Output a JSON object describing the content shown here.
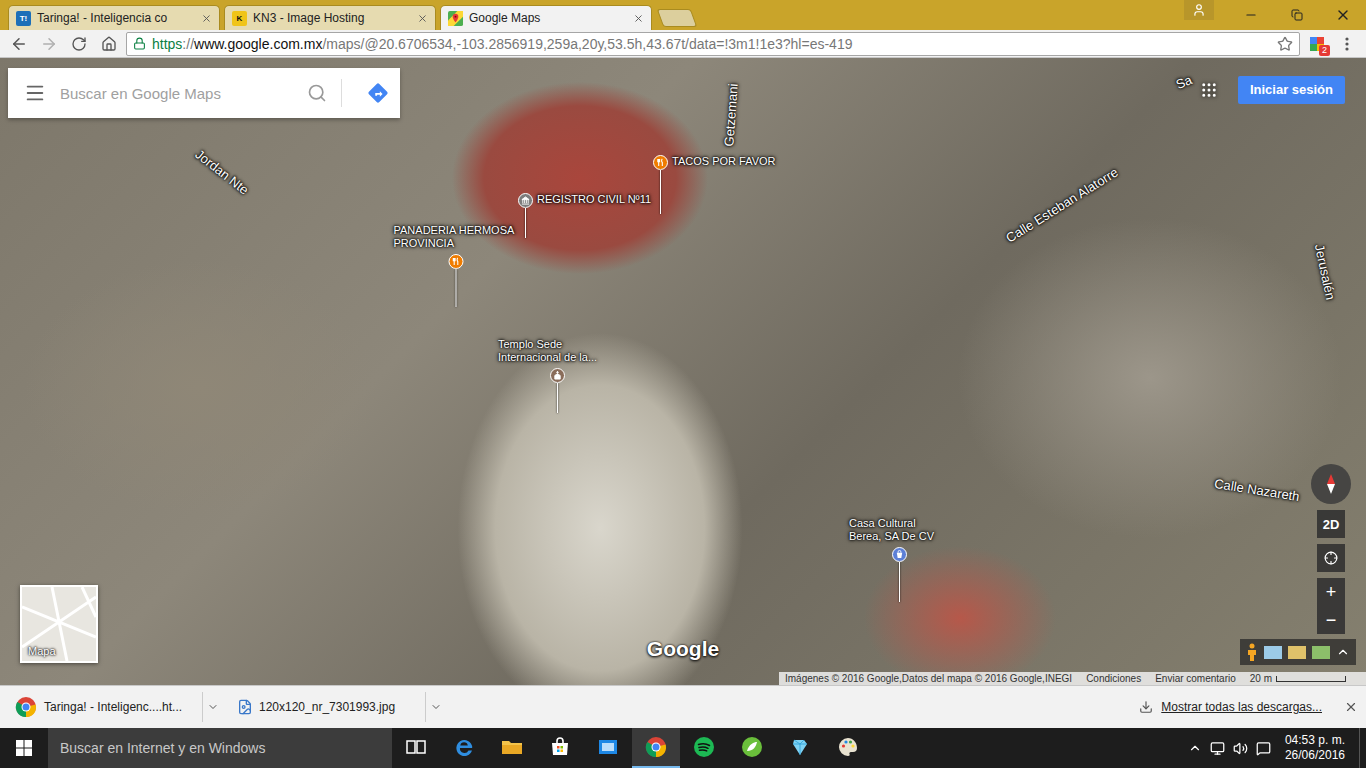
{
  "browser": {
    "tabs": [
      {
        "label": "Taringa! - Inteligencia co",
        "kind": "letter",
        "favicon": "T!",
        "selected": false
      },
      {
        "label": "KN3 - Image Hosting",
        "kind": "letter",
        "favicon": "K",
        "selected": false
      },
      {
        "label": "Google Maps",
        "kind": "maps",
        "favicon": "",
        "selected": true
      }
    ],
    "url": {
      "scheme": "https",
      "separator": "://",
      "host": "www.google.com.mx",
      "path": "/maps/@20.6706534,-103.2856919,259a,20y,53.5h,43.67t/data=!3m1!1e3?hl=es-419"
    },
    "bookmarked": false,
    "extension_badge": "2"
  },
  "map": {
    "search_placeholder": "Buscar en Google Maps",
    "sign_in": "Iniciar sesión",
    "streets": [
      "Jordan Nte",
      "Getzemani",
      "Calle Esteban Alatorre",
      "Jerusalén",
      "Calle Nazareth",
      "Sa"
    ],
    "places": [
      {
        "label": "TACOS POR FAVOR",
        "kind": "restaurant"
      },
      {
        "label": "REGISTRO CIVIL Nº11",
        "kind": "civic"
      },
      {
        "label": "PANADERIA HERMOSA PROVINCIA",
        "kind": "restaurant"
      },
      {
        "label": "Templo Sede Internacional de la...",
        "kind": "church"
      },
      {
        "label": "Casa Cultural Berea, SA De CV",
        "kind": "shop"
      }
    ],
    "minimap_label": "Mapa",
    "view_toggle": "2D",
    "zoom_in": "+",
    "zoom_out": "−",
    "logo": "Google",
    "attribution": [
      "Imágenes © 2016 Google,Datos del mapa © 2016 Google,INEGI",
      "Condiciones",
      "Enviar comentario"
    ],
    "scale": "20 m"
  },
  "downloads": {
    "items": [
      {
        "label": "Taringa! - Inteligenc....ht...",
        "kind": "page"
      },
      {
        "label": "120x120_nr_7301993.jpg",
        "kind": "image"
      }
    ],
    "show_all": "Mostrar todas las descargas..."
  },
  "taskbar": {
    "search_placeholder": "Buscar en Internet y en Windows",
    "apps": [
      {
        "kind": "task-view",
        "selected": false
      },
      {
        "kind": "edge",
        "selected": false
      },
      {
        "kind": "explorer",
        "selected": false
      },
      {
        "kind": "store",
        "selected": false
      },
      {
        "kind": "mail",
        "selected": false
      },
      {
        "kind": "chrome",
        "selected": true
      },
      {
        "kind": "spotify",
        "selected": false
      },
      {
        "kind": "leaf",
        "selected": false
      },
      {
        "kind": "crystal",
        "selected": false
      },
      {
        "kind": "paint",
        "selected": false
      }
    ],
    "time": "04:53 p. m.",
    "date": "26/06/2016"
  }
}
